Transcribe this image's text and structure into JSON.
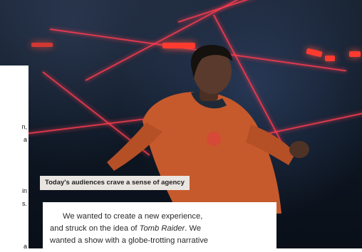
{
  "caption": "Today's audiences crave a sense of agency",
  "left_fragments": [
    "n,",
    "a",
    "in",
    "s.",
    "a"
  ],
  "article": {
    "line1": "We wanted to create a new experience,",
    "line2_pre": "and struck on the idea of ",
    "line2_em": "Tomb Raider",
    "line2_post": ". We",
    "line3": "wanted a show with a globe-trotting narrative"
  },
  "colors": {
    "caption_bg": "#e9e5e1",
    "laser": "#ff3c50",
    "jacket": "#c65a2c"
  }
}
